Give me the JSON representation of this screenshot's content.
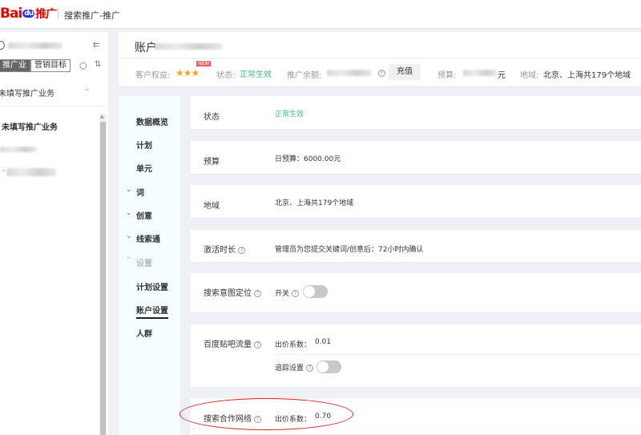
{
  "topbar": {
    "logo_text": "Bai",
    "logo_du": "du",
    "logo_suffix": "推广",
    "title": "搜索推广-推广"
  },
  "left": {
    "tabs": [
      "推广业务",
      "营销目标"
    ],
    "dropdown": "未填写推广业务",
    "tree_root": "未填写推广业务"
  },
  "header": {
    "account_label": "账户",
    "rights_label": "客户权益:",
    "new_badge": "NEW",
    "stars": 3,
    "status_label": "状态:",
    "status_value": "正常生效",
    "balance_label": "推广余额:",
    "recharge_button": "充值",
    "budget_label": "预算:",
    "budget_suffix": "元",
    "region_label": "地域:",
    "region_value": "北京、上海共179个地域"
  },
  "nav": {
    "items": [
      "数据概览",
      "计划",
      "单元",
      "词",
      "创意",
      "线索通",
      "设置",
      "计划设置",
      "账户设置",
      "人群"
    ]
  },
  "rows": {
    "status": {
      "label": "状态",
      "value": "正常生效"
    },
    "budget": {
      "label": "预算",
      "value": "日预算：6000.00元"
    },
    "region": {
      "label": "地域",
      "value": "北京、上海共179个地域"
    },
    "activation": {
      "label": "激活时长",
      "value": "管理员为您提交关键词/创意后：72小时内确认"
    },
    "intent": {
      "label": "搜索意图定位",
      "switch_label": "开关",
      "switch_on": false
    },
    "tieba": {
      "label": "百度贴吧流量",
      "bid_label": "出价系数：",
      "bid_value": "0.01",
      "track_label": "追踪设置",
      "track_on": false
    },
    "network": {
      "label": "搜索合作网络",
      "bid_label": "出价系数：",
      "bid_value": "0.70"
    }
  },
  "colors": {
    "brand_red": "#e10601",
    "status_green": "#3dba8a",
    "annotation_red": "#e02020"
  }
}
